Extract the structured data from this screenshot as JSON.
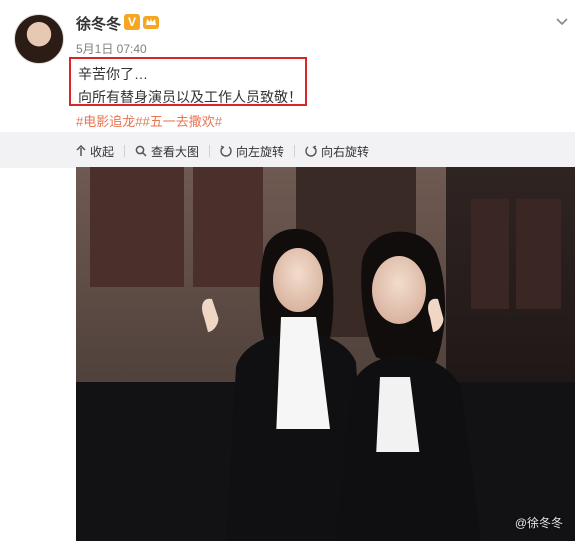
{
  "post": {
    "author": "徐冬冬",
    "verified_badge": "V",
    "time": "5月1日 07:40",
    "text_line1": "辛苦你了…",
    "text_line2": "向所有替身演员以及工作人员致敬！",
    "hashtags": "#电影追龙##五一去撒欢#"
  },
  "toolbar": {
    "collapse": "收起",
    "view_large": "查看大图",
    "rotate_left": "向左旋转",
    "rotate_right": "向右旋转"
  },
  "image": {
    "watermark": "@徐冬冬"
  },
  "colors": {
    "highlight_border": "#d6262a",
    "hashtag": "#eb7350",
    "verified_badge": "#f5a623"
  }
}
